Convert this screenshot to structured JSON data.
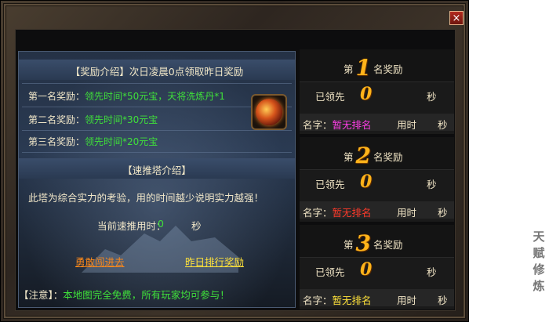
{
  "window": {
    "close_label": "×"
  },
  "reward_intro": {
    "title": "【奖励介绍】次日凌晨0点领取昨日奖励",
    "rows": [
      {
        "label": "第一名奖励：",
        "value": "领先时间*50元宝，天将洗炼丹*1"
      },
      {
        "label": "第二名奖励：",
        "value": "领先时间*30元宝"
      },
      {
        "label": "第三名奖励：",
        "value": "领先时间*20元宝"
      }
    ]
  },
  "tower_intro": {
    "title": "【速推塔介绍】",
    "description": "此塔为综合实力的考验，用的时间越少说明实力越强！",
    "timer_label": "当前速推用时：",
    "timer_value": "0",
    "timer_unit": "秒"
  },
  "actions": {
    "enter": "勇敢闯进去",
    "yesterday_rank": "昨日排行奖励"
  },
  "notice": {
    "label": "【注意】：",
    "text": "本地图完全免费，所有玩家均可参与！"
  },
  "rankings": [
    {
      "prefix": "第",
      "rank": "1",
      "suffix": "名奖励",
      "got_label": "已领先",
      "got_value": "0",
      "sec": "秒",
      "name_label": "名字：",
      "name_value": "暂无排名",
      "name_color": "#ff3ee8",
      "time_label": "用时",
      "time_unit": "秒"
    },
    {
      "prefix": "第",
      "rank": "2",
      "suffix": "名奖励",
      "got_label": "已领先",
      "got_value": "0",
      "sec": "秒",
      "name_label": "名字：",
      "name_value": "暂无排名",
      "name_color": "#ff3a2a",
      "time_label": "用时",
      "time_unit": "秒"
    },
    {
      "prefix": "第",
      "rank": "3",
      "suffix": "名奖励",
      "got_label": "已领先",
      "got_value": "0",
      "sec": "秒",
      "name_label": "名字：",
      "name_value": "暂无排名",
      "name_color": "#ffe23a",
      "time_label": "用时",
      "time_unit": "秒"
    }
  ],
  "side_label": "天赋修炼"
}
